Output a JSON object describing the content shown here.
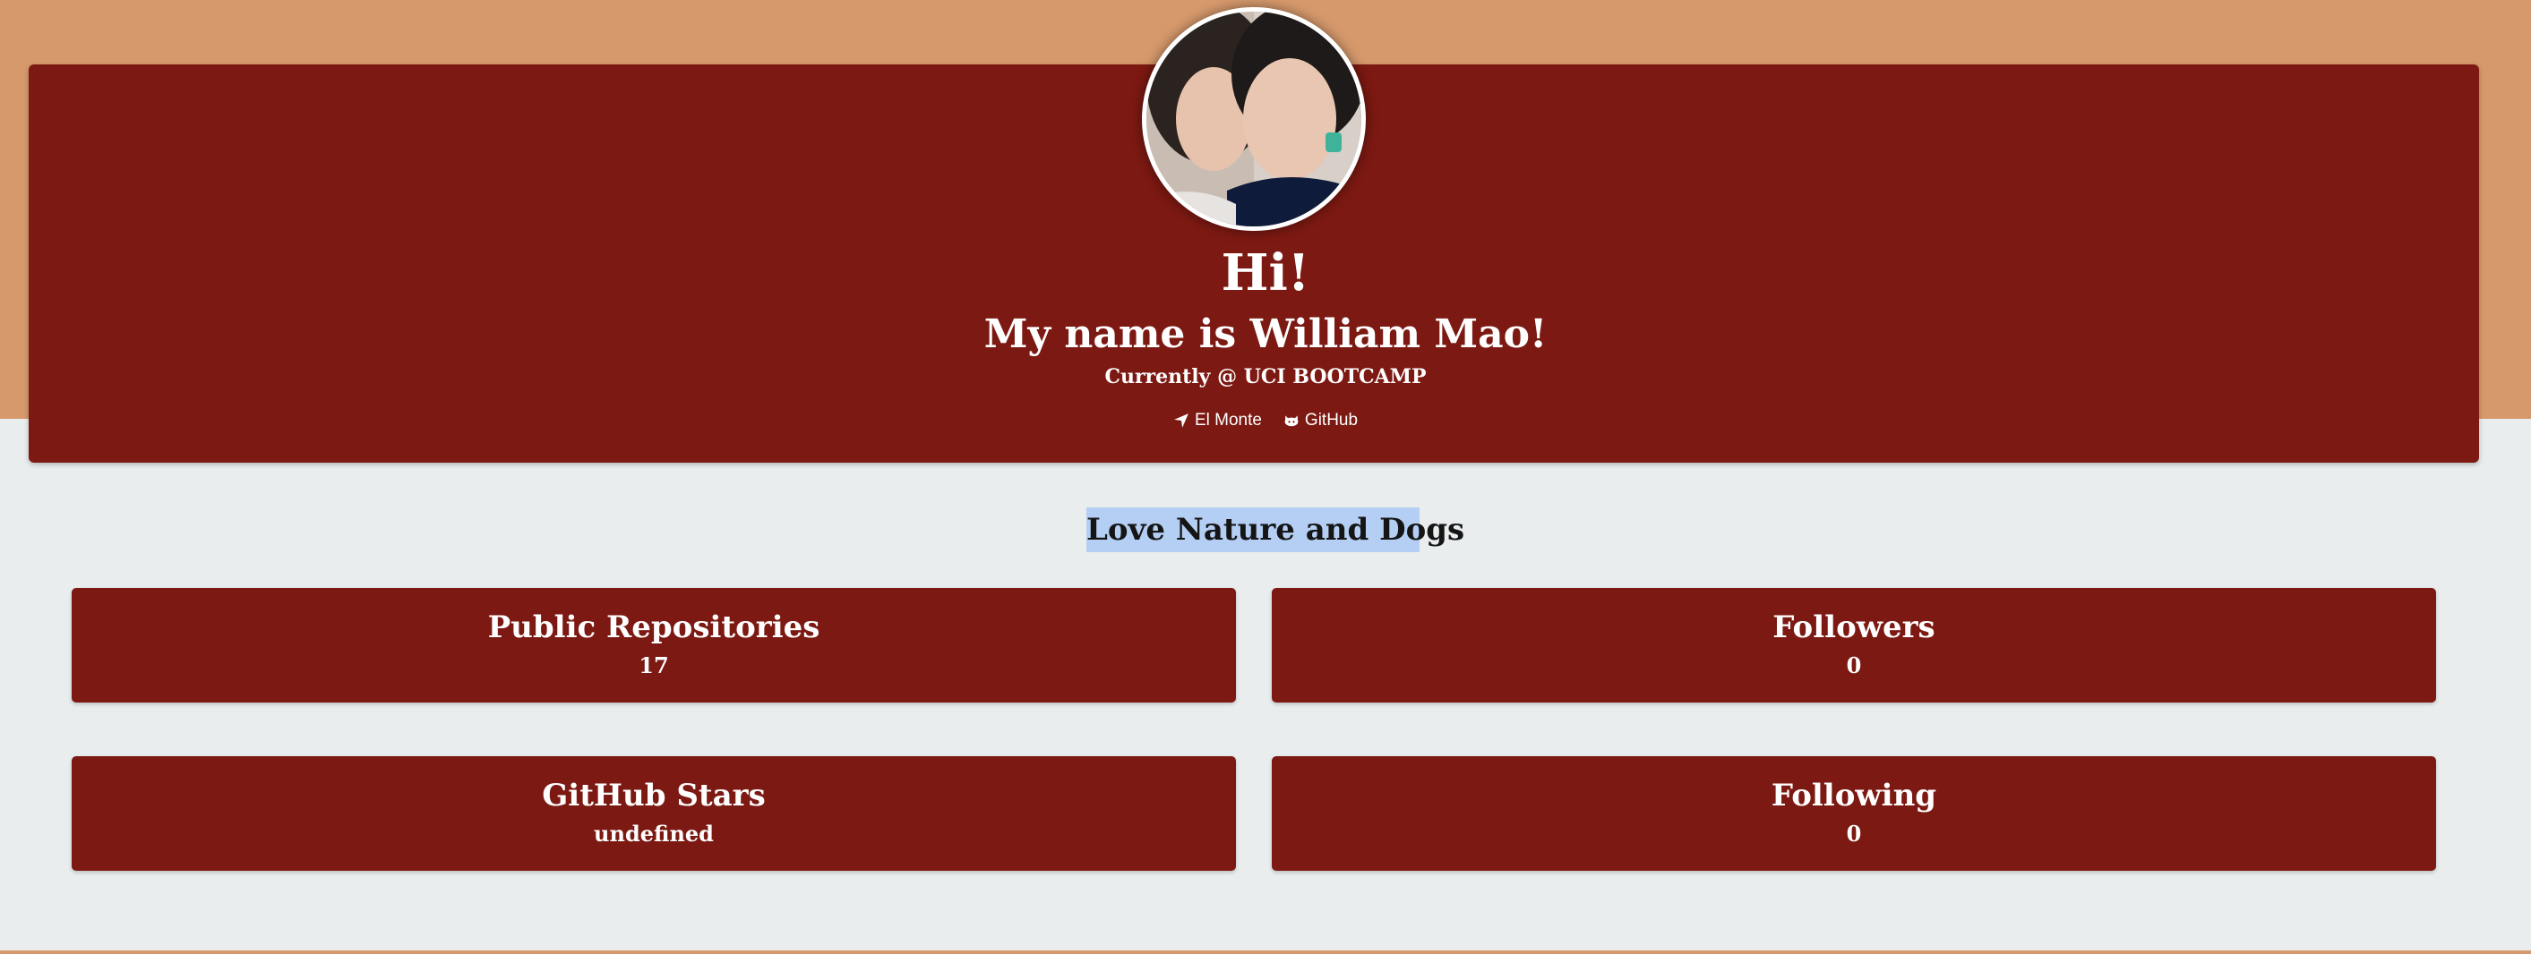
{
  "header": {
    "greeting": "Hi!",
    "name_line": "My name is William Mao!",
    "current": "Currently @ UCI BOOTCAMP",
    "links": [
      {
        "label": "El Monte",
        "icon": "location-arrow-icon"
      },
      {
        "label": "GitHub",
        "icon": "github-icon"
      }
    ]
  },
  "bio": "Love Nature and Dogs",
  "stats": {
    "repos": {
      "title": "Public Repositories",
      "value": "17"
    },
    "followers": {
      "title": "Followers",
      "value": "0"
    },
    "stars": {
      "title": "GitHub Stars",
      "value": "undefined"
    },
    "following": {
      "title": "Following",
      "value": "0"
    }
  },
  "colors": {
    "band": "#d6996c",
    "card": "#7c1912",
    "background": "#e9edee",
    "highlight": "#b4cff3"
  }
}
